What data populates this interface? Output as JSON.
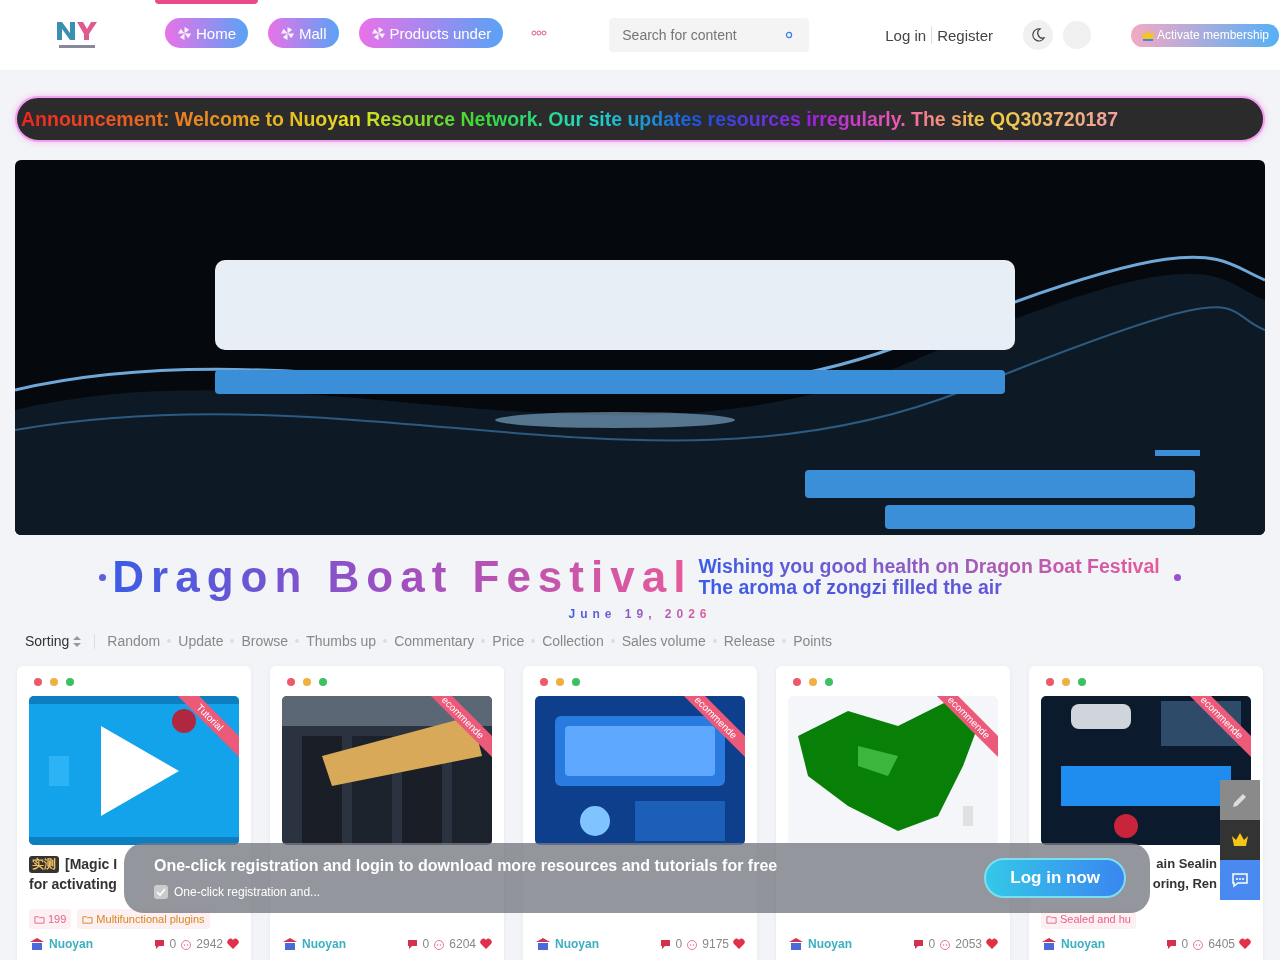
{
  "header": {
    "nav": [
      {
        "label": "Home",
        "selected": true
      },
      {
        "label": "Mall",
        "selected": false
      },
      {
        "label": "Products under",
        "selected": false
      }
    ],
    "search": {
      "placeholder": "Search for content"
    },
    "auth": [
      "Log in",
      "Register"
    ],
    "membership": "Activate membership"
  },
  "announcement": "Announcement: Welcome to Nuoyan Resource Network. Our site updates resources irregularly. The site QQ303720187",
  "festival": {
    "title": "Dragon Boat Festival",
    "lines": [
      "Wishing you good health on Dragon Boat Festival",
      "The aroma of zongzi filled the air"
    ],
    "date": "June 19, 2026"
  },
  "sorting": {
    "label": "Sorting",
    "options": [
      "Random",
      "Update",
      "Browse",
      "Thumbs up",
      "Commentary",
      "Price",
      "Collection",
      "Sales volume",
      "Release",
      "Points"
    ]
  },
  "cards": [
    {
      "ribbon": "Tutorial",
      "badge": "实测",
      "title_lines": [
        "[Magic I",
        "for activating"
      ],
      "tags": [
        {
          "text": "199",
          "color": "#e8628c"
        },
        {
          "text": "Multifunctional plugins",
          "color": "#d9861c"
        }
      ],
      "author": "Nuoyan",
      "comments": "0",
      "views": "2942"
    },
    {
      "ribbon": "ecommende",
      "author": "Nuoyan",
      "comments": "0",
      "views": "6204"
    },
    {
      "ribbon": "ecommende",
      "author": "Nuoyan",
      "comments": "0",
      "views": "9175"
    },
    {
      "ribbon": "ecommende",
      "author": "Nuoyan",
      "comments": "0",
      "views": "2053"
    },
    {
      "ribbon": "ecommende",
      "title_lines": [
        "ain Sealin",
        "oring, Ren"
      ],
      "tags": [
        {
          "text": "Sealed and hu",
          "color": "#e8628c"
        }
      ],
      "author": "Nuoyan",
      "comments": "0",
      "views": "6405"
    }
  ],
  "promo": {
    "text": "One-click registration and login to download more resources and tutorials for free",
    "checkbox": {
      "label": "One-click registration and...",
      "checked": true
    },
    "button": "Log in now"
  }
}
